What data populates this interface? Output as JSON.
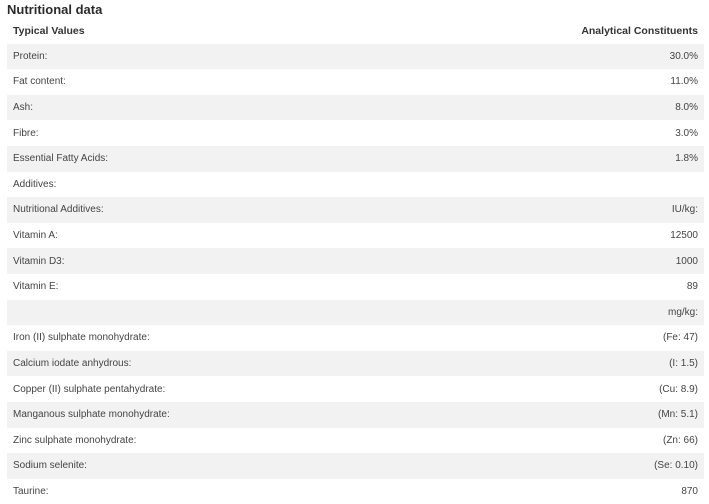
{
  "title": "Nutritional data",
  "table": {
    "headers": [
      "Typical Values",
      "Analytical Constituents"
    ],
    "rows": [
      [
        "Protein:",
        "30.0%"
      ],
      [
        "Fat content:",
        "11.0%"
      ],
      [
        "Ash:",
        "8.0%"
      ],
      [
        "Fibre:",
        "3.0%"
      ],
      [
        "Essential Fatty Acids:",
        "1.8%"
      ],
      [
        "Additives:",
        ""
      ],
      [
        "Nutritional Additives:",
        "IU/kg:"
      ],
      [
        "Vitamin A:",
        "12500"
      ],
      [
        "Vitamin D3:",
        "1000"
      ],
      [
        "Vitamin E:",
        "89"
      ],
      [
        "",
        "mg/kg:"
      ],
      [
        "Iron (II) sulphate monohydrate:",
        "(Fe: 47)"
      ],
      [
        "Calcium iodate anhydrous:",
        "(I: 1.5)"
      ],
      [
        "Copper (II) sulphate pentahydrate:",
        "(Cu: 8.9)"
      ],
      [
        "Manganous sulphate monohydrate:",
        "(Mn: 5.1)"
      ],
      [
        "Zinc sulphate monohydrate:",
        "(Zn: 66)"
      ],
      [
        "Sodium selenite:",
        "(Se: 0.10)"
      ],
      [
        "Taurine:",
        "870"
      ]
    ]
  }
}
